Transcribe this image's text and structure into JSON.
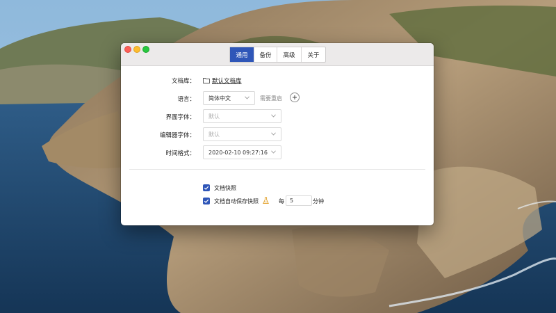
{
  "window": {
    "tabs": [
      {
        "label": "通用",
        "active": true
      },
      {
        "label": "备份",
        "active": false
      },
      {
        "label": "高级",
        "active": false
      },
      {
        "label": "关于",
        "active": false
      }
    ]
  },
  "settings": {
    "library": {
      "label": "文档库：",
      "value": "默认文档库"
    },
    "language": {
      "label": "语言：",
      "value": "简体中文",
      "hint": "需要重启"
    },
    "ui_font": {
      "label": "界面字体：",
      "placeholder": "默认"
    },
    "editor_font": {
      "label": "编辑器字体：",
      "placeholder": "默认"
    },
    "time_format": {
      "label": "时间格式：",
      "value": "2020-02-10 09:27:16"
    }
  },
  "snapshots": {
    "snapshot": {
      "label": "文档快照",
      "checked": true
    },
    "autosave": {
      "label": "文档自动保存快照",
      "checked": true,
      "every_label": "每",
      "interval": "5",
      "unit_label": "分钟"
    }
  },
  "colors": {
    "accent": "#2f56b8",
    "traffic_close": "#fc5f57",
    "traffic_min": "#fdbd2e",
    "traffic_max": "#28c840",
    "flask_icon": "#e2a12b"
  },
  "icons": [
    "folder-icon",
    "chevron-down-icon",
    "plus-icon",
    "checkmark-icon",
    "flask-icon"
  ]
}
